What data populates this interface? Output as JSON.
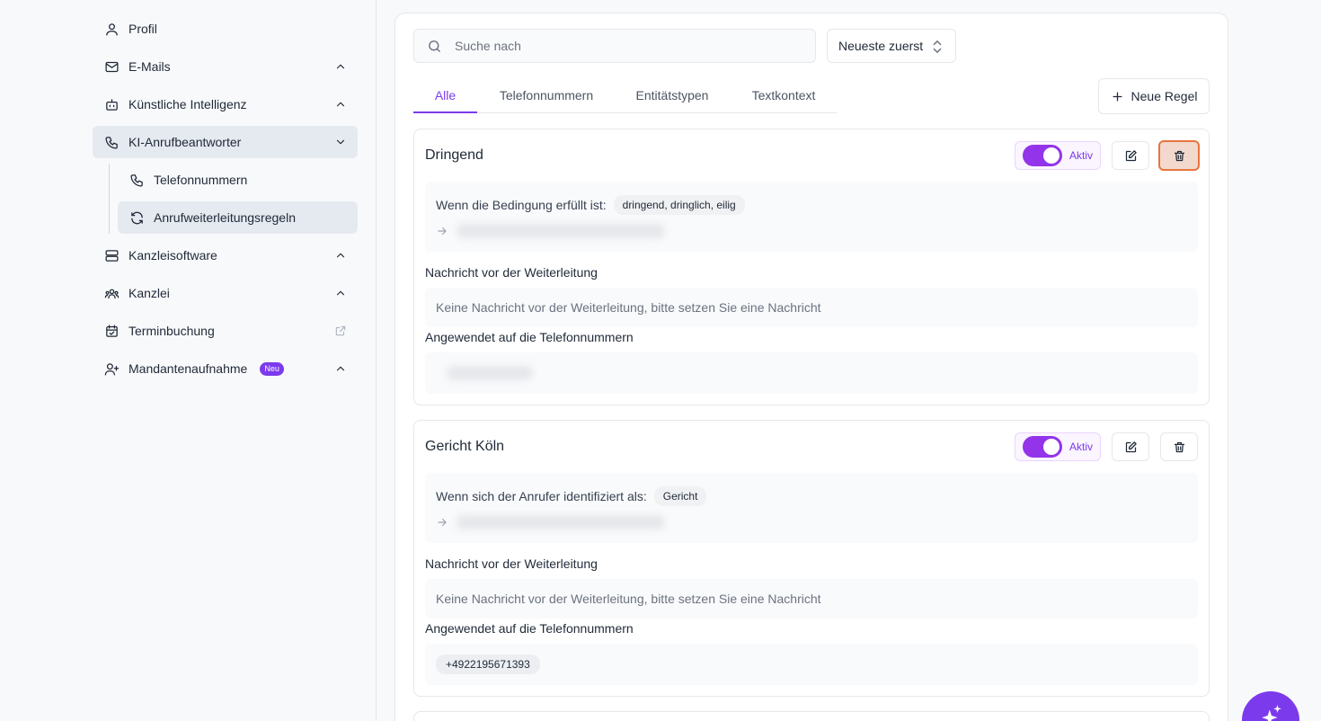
{
  "sidebar": {
    "items": [
      {
        "label": "Profil",
        "icon": "user-icon"
      },
      {
        "label": "E-Mails",
        "icon": "mail-icon"
      },
      {
        "label": "Künstliche Intelligenz",
        "icon": "bot-icon"
      },
      {
        "label": "KI-Anrufbeantworter",
        "icon": "phone-icon"
      },
      {
        "label": "Telefonnummern",
        "icon": "phone-icon"
      },
      {
        "label": "Anrufweiterleitungsregeln",
        "icon": "refresh-icon"
      },
      {
        "label": "Kanzleisoftware",
        "icon": "server-icon"
      },
      {
        "label": "Kanzlei",
        "icon": "users-icon"
      },
      {
        "label": "Terminbuchung",
        "icon": "calendar-check-icon"
      },
      {
        "label": "Mandantenaufnahme",
        "icon": "user-plus-icon",
        "badge": "Neu"
      }
    ]
  },
  "search": {
    "placeholder": "Suche nach"
  },
  "sort": {
    "label": "Neueste zuerst"
  },
  "tabs": [
    {
      "label": "Alle"
    },
    {
      "label": "Telefonnummern"
    },
    {
      "label": "Entitätstypen"
    },
    {
      "label": "Textkontext"
    }
  ],
  "new_rule_label": "Neue Regel",
  "rules": [
    {
      "title": "Dringend",
      "status": "Aktiv",
      "condition": "Wenn die Bedingung erfüllt ist:",
      "condition_value": "dringend, dringlich, eilig",
      "message_label": "Nachricht vor der Weiterleitung",
      "message": "Keine Nachricht vor der Weiterleitung, bitte setzen Sie eine Nachricht",
      "applied_label": "Angewendet auf die Telefonnummern"
    },
    {
      "title": "Gericht Köln",
      "status": "Aktiv",
      "condition": "Wenn sich der Anrufer identifiziert als:",
      "condition_value": "Gericht",
      "message_label": "Nachricht vor der Weiterleitung",
      "message": "Keine Nachricht vor der Weiterleitung, bitte setzen Sie eine Nachricht",
      "applied_label": "Angewendet auf die Telefonnummern",
      "phone": "+4922195671393"
    }
  ],
  "colors": {
    "accent": "#7c3aed",
    "danger_border": "#e8743f"
  }
}
